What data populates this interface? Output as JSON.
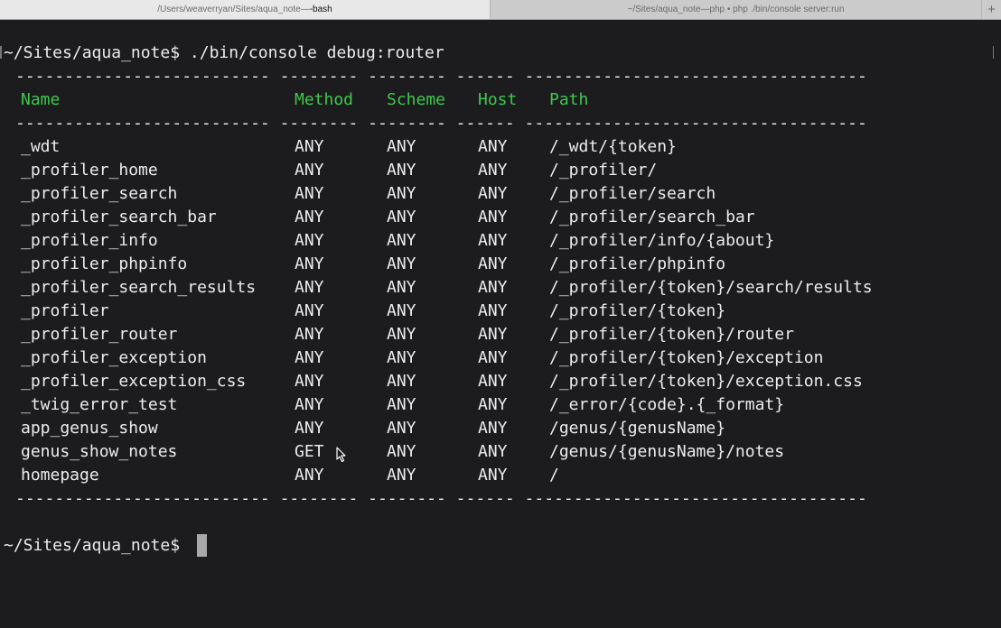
{
  "tabs": [
    {
      "path": "/Users/weaverryan/Sites/aqua_note",
      "sep": " — ",
      "cmd": "-bash",
      "active": true
    },
    {
      "path": "~/Sites/aqua_note",
      "sep": " — ",
      "cmd": "php • php ./bin/console server:run",
      "active": false
    }
  ],
  "new_tab_symbol": "+",
  "prompt": "~/Sites/aqua_note$",
  "command": " ./bin/console debug:router",
  "separator_line": "-------------------------- -------- -------- ------ -----------------------------------",
  "headers": {
    "name": "Name",
    "method": "Method",
    "scheme": "Scheme",
    "host": "Host",
    "path": "Path"
  },
  "routes": [
    {
      "name": "_wdt",
      "method": "ANY",
      "scheme": "ANY",
      "host": "ANY",
      "path": "/_wdt/{token}"
    },
    {
      "name": "_profiler_home",
      "method": "ANY",
      "scheme": "ANY",
      "host": "ANY",
      "path": "/_profiler/"
    },
    {
      "name": "_profiler_search",
      "method": "ANY",
      "scheme": "ANY",
      "host": "ANY",
      "path": "/_profiler/search"
    },
    {
      "name": "_profiler_search_bar",
      "method": "ANY",
      "scheme": "ANY",
      "host": "ANY",
      "path": "/_profiler/search_bar"
    },
    {
      "name": "_profiler_info",
      "method": "ANY",
      "scheme": "ANY",
      "host": "ANY",
      "path": "/_profiler/info/{about}"
    },
    {
      "name": "_profiler_phpinfo",
      "method": "ANY",
      "scheme": "ANY",
      "host": "ANY",
      "path": "/_profiler/phpinfo"
    },
    {
      "name": "_profiler_search_results",
      "method": "ANY",
      "scheme": "ANY",
      "host": "ANY",
      "path": "/_profiler/{token}/search/results"
    },
    {
      "name": "_profiler",
      "method": "ANY",
      "scheme": "ANY",
      "host": "ANY",
      "path": "/_profiler/{token}"
    },
    {
      "name": "_profiler_router",
      "method": "ANY",
      "scheme": "ANY",
      "host": "ANY",
      "path": "/_profiler/{token}/router"
    },
    {
      "name": "_profiler_exception",
      "method": "ANY",
      "scheme": "ANY",
      "host": "ANY",
      "path": "/_profiler/{token}/exception"
    },
    {
      "name": "_profiler_exception_css",
      "method": "ANY",
      "scheme": "ANY",
      "host": "ANY",
      "path": "/_profiler/{token}/exception.css"
    },
    {
      "name": "_twig_error_test",
      "method": "ANY",
      "scheme": "ANY",
      "host": "ANY",
      "path": "/_error/{code}.{_format}"
    },
    {
      "name": "app_genus_show",
      "method": "ANY",
      "scheme": "ANY",
      "host": "ANY",
      "path": "/genus/{genusName}"
    },
    {
      "name": "genus_show_notes",
      "method": "GET",
      "scheme": "ANY",
      "host": "ANY",
      "path": "/genus/{genusName}/notes"
    },
    {
      "name": "homepage",
      "method": "ANY",
      "scheme": "ANY",
      "host": "ANY",
      "path": "/"
    }
  ],
  "colors": {
    "background": "#1c1c1e",
    "text": "#ececec",
    "header_green": "#3fc84e",
    "cursor": "#a8a8a8"
  },
  "icons": {
    "mouse_pointer": "arrow-cursor-icon"
  }
}
